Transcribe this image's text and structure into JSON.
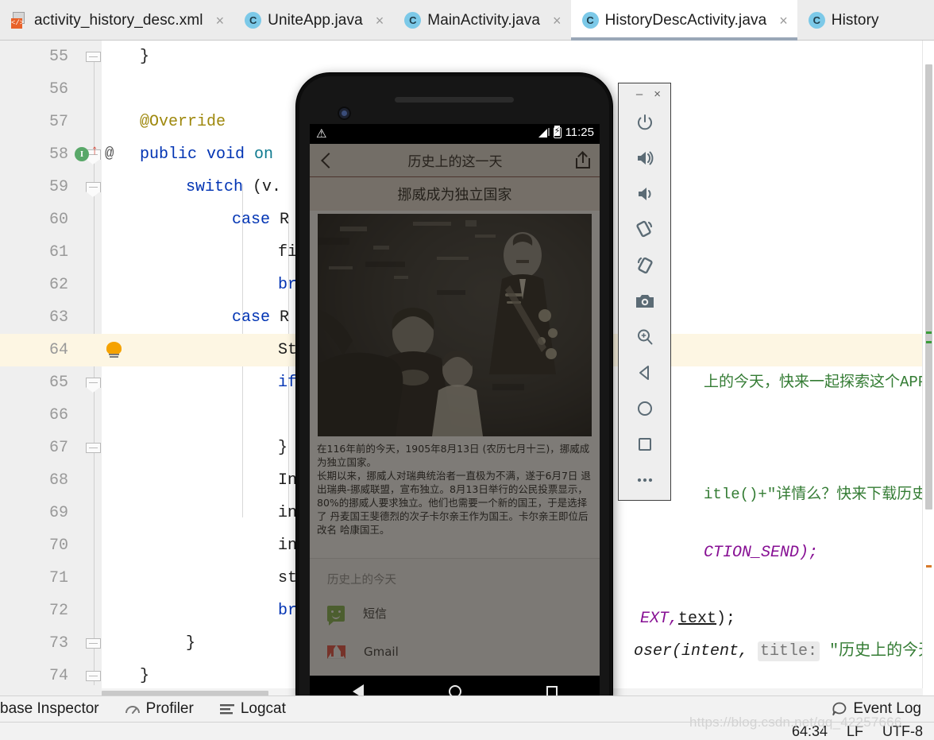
{
  "ide": {
    "tabs": [
      {
        "label": "activity_history_desc.xml",
        "icon": "xml-file-icon",
        "active": false,
        "closable": true
      },
      {
        "label": "UniteApp.java",
        "icon": "java-class-icon",
        "active": false,
        "closable": true
      },
      {
        "label": "MainActivity.java",
        "icon": "java-class-icon",
        "active": false,
        "closable": true
      },
      {
        "label": "HistoryDescActivity.java",
        "icon": "java-class-icon",
        "active": true,
        "closable": true
      },
      {
        "label": "History",
        "icon": "java-class-icon",
        "active": false,
        "closable": false
      }
    ],
    "close_glyph": "×",
    "editor": {
      "lines": [
        {
          "num": "55",
          "text": "        }"
        },
        {
          "num": "56",
          "text": ""
        },
        {
          "num": "57",
          "text": "        @Override"
        },
        {
          "num": "58",
          "text": "        public void on"
        },
        {
          "num": "59",
          "text": "            switch (v."
        },
        {
          "num": "60",
          "text": "                case R"
        },
        {
          "num": "61",
          "text": "                    fi"
        },
        {
          "num": "62",
          "text": "                    br"
        },
        {
          "num": "63",
          "text": "                case R"
        },
        {
          "num": "64",
          "text": "                    St"
        },
        {
          "num": "65",
          "text": "                    if"
        },
        {
          "num": "66",
          "text": ""
        },
        {
          "num": "67",
          "text": "                    }"
        },
        {
          "num": "68",
          "text": "                    In"
        },
        {
          "num": "69",
          "text": "                    in"
        },
        {
          "num": "70",
          "text": "                    in"
        },
        {
          "num": "71",
          "text": "                    st"
        },
        {
          "num": "72",
          "text": "                    br"
        },
        {
          "num": "73",
          "text": "            }"
        },
        {
          "num": "74",
          "text": "        }"
        }
      ],
      "current_line": "64",
      "gutter_badge": "I",
      "gutter_at": "@",
      "right_fragments": {
        "line_64_tail": "上的今天，快来一起探索这个APP吧",
        "line_65_tail": "itle()+\"详情么？快来下载历史",
        "line_68_tail": "CTION_SEND);",
        "line_70_tail": "EXT,",
        "line_70_field": "text",
        "line_70_end": ");",
        "line_71_head": "oser(intent, ",
        "line_71_param": "title:",
        "line_71_str": "\"历史上的今天\")"
      }
    },
    "toolwindows": [
      {
        "label": "base Inspector",
        "icon": "database-inspector-icon"
      },
      {
        "label": "Profiler",
        "icon": "profiler-icon"
      },
      {
        "label": "Logcat",
        "icon": "logcat-icon"
      }
    ],
    "event_log": {
      "label": "Event Log",
      "icon": "event-log-icon"
    },
    "status": {
      "caret": "64:34",
      "line_sep": "LF",
      "encoding": "UTF-8"
    },
    "watermark": "https://blog.csdn.net/qq_42257666"
  },
  "emulator": {
    "window_buttons": {
      "minimize": "–",
      "close": "×"
    },
    "toolbar_buttons": [
      {
        "name": "power-icon",
        "label": "Power"
      },
      {
        "name": "volume-up-icon",
        "label": "Volume Up"
      },
      {
        "name": "volume-down-icon",
        "label": "Volume Down"
      },
      {
        "name": "rotate-left-icon",
        "label": "Rotate Left"
      },
      {
        "name": "rotate-right-icon",
        "label": "Rotate Right"
      },
      {
        "name": "screenshot-icon",
        "label": "Take Screenshot"
      },
      {
        "name": "zoom-icon",
        "label": "Zoom Mode"
      },
      {
        "name": "back-icon",
        "label": "Back"
      },
      {
        "name": "home-icon",
        "label": "Home"
      },
      {
        "name": "overview-icon",
        "label": "Overview"
      },
      {
        "name": "more-icon",
        "label": "More"
      }
    ],
    "device": {
      "status_bar": {
        "time": "11:25",
        "warning_icon": "warning-triangle-icon",
        "signal_icon": "signal-icon",
        "battery_icon": "battery-charging-icon"
      },
      "app": {
        "appbar_title": "历史上的这一天",
        "back_icon": "back-chevron-icon",
        "share_icon": "share-icon",
        "article_title": "挪威成为独立国家",
        "article_image": "historic-royal-family-photo",
        "article_body": "在116年前的今天，1905年8月13日 (农历七月十三)，挪威成为独立国家。\n长期以来，挪威人对瑞典统治者一直极为不满，遂于6月7日 退出瑞典-挪威联盟，宣布独立。8月13日举行的公民投票显示，80%的挪威人要求独立。他们也需要一个新的国王，于是选择了 丹麦国王斐德烈的次子卡尔亲王作为国王。卡尔亲王即位后改名 哈康国王。"
      },
      "share_sheet": {
        "title": "历史上的今天",
        "items": [
          {
            "label": "短信",
            "icon": "sms-icon"
          },
          {
            "label": "Gmail",
            "icon": "gmail-icon"
          }
        ]
      },
      "nav_bar": {
        "back": "nav-back-icon",
        "home": "nav-home-icon",
        "recents": "nav-recents-icon"
      }
    }
  },
  "colors": {
    "tab_active_underline": "#9aa7b7",
    "java_icon": "#7cc9e8",
    "xml_icon": "#e8622a",
    "keyword": "#0033b3",
    "string": "#347c34",
    "annotation": "#9e880d",
    "static_field": "#871094",
    "current_line": "#fdf6e3",
    "bulb": "#f5a200",
    "sms_green": "#7cb342",
    "gmail_red": "#ea4335"
  }
}
